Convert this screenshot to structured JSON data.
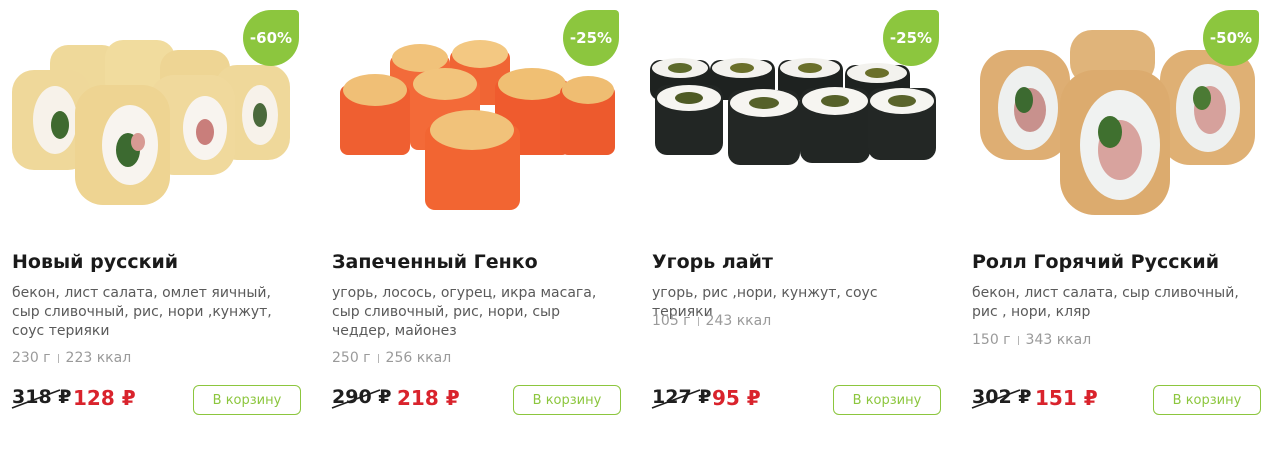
{
  "products": [
    {
      "badge": "-60%",
      "title": "Новый русский",
      "description": "бекон, лист салата, омлет яичный, сыр сливочный, рис, нори ,кунжут, соус терияки",
      "weight": "230 г",
      "calories": "223 ккал",
      "old_price": "318 ₽",
      "new_price": "128 ₽",
      "cart_label": "В корзину",
      "image": "sushi-roll-omelette"
    },
    {
      "badge": "-25%",
      "title": "Запеченный Генко",
      "description": "угорь, лосось, огурец, икра масага, сыр сливочный, рис, нори, сыр чеддер, майонез",
      "weight": "250 г",
      "calories": "256 ккал",
      "old_price": "290 ₽",
      "new_price": "218 ₽",
      "cart_label": "В корзину",
      "image": "baked-roll-masago"
    },
    {
      "badge": "-25%",
      "title": "Угорь лайт",
      "description": "угорь, рис ,нори, кунжут, соус терияки",
      "weight": "105 г",
      "calories": "243 ккал",
      "old_price": "127 ₽",
      "new_price": "95 ₽",
      "cart_label": "В корзину",
      "image": "eel-maki-roll"
    },
    {
      "badge": "-50%",
      "title": "Ролл Горячий Русский",
      "description": "бекон, лист салата, сыр сливочный, рис , нори, кляр",
      "weight": "150 г",
      "calories": "343 ккал",
      "old_price": "302 ₽",
      "new_price": "151 ₽",
      "cart_label": "В корзину",
      "image": "tempura-hot-roll"
    }
  ],
  "colors": {
    "accent": "#8cc63e",
    "sale_price": "#d9232c"
  }
}
